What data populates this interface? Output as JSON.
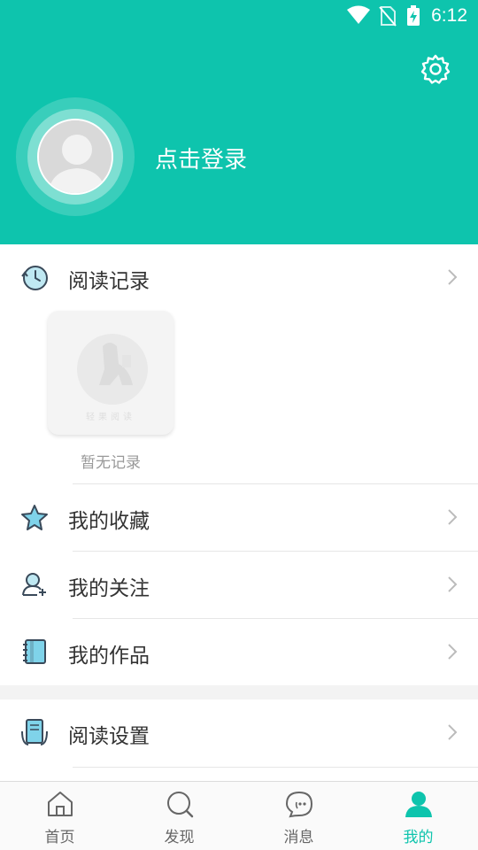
{
  "status_bar": {
    "time": "6:12"
  },
  "profile": {
    "login_prompt": "点击登录"
  },
  "reading_history": {
    "label": "阅读记录",
    "empty_text": "暂无记录",
    "placeholder_watermark": "轻果阅读"
  },
  "menu": {
    "favorites": "我的收藏",
    "following": "我的关注",
    "works": "我的作品",
    "reading_settings": "阅读设置"
  },
  "tabs": [
    {
      "label": "首页",
      "icon": "home-icon"
    },
    {
      "label": "发现",
      "icon": "discover-icon"
    },
    {
      "label": "消息",
      "icon": "message-icon"
    },
    {
      "label": "我的",
      "icon": "profile-icon",
      "active": true
    }
  ],
  "colors": {
    "accent": "#0ec4ad",
    "text": "#333333",
    "muted": "#999999"
  }
}
